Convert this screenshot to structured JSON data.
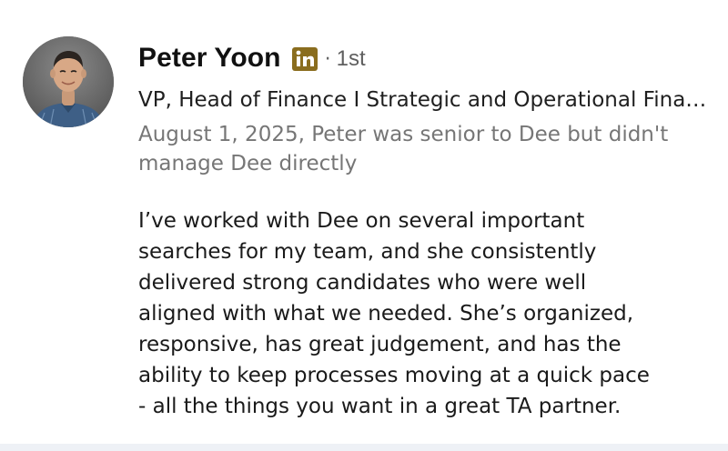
{
  "recommendation": {
    "author": {
      "name": "Peter Yoon",
      "badge_icon": "linkedin-icon",
      "badge_color": "#8a6d1e",
      "separator": "·",
      "connection_degree": "1st",
      "headline": "VP, Head of Finance I Strategic and Operational Finance Leader"
    },
    "relationship": "August 1, 2025, Peter was senior to Dee but didn't manage Dee directly",
    "text": "I’ve worked with Dee on several important\nsearches for my team, and she consistently\ndelivered strong candidates who were well\naligned with what we needed. She’s organized,\nresponsive, has great judgement, and has the\nability to keep processes moving at a quick pace\n- all the things you want in a great TA partner."
  },
  "colors": {
    "name": "#111111",
    "secondary_text": "#767676",
    "body_text": "#1a1a1a"
  }
}
